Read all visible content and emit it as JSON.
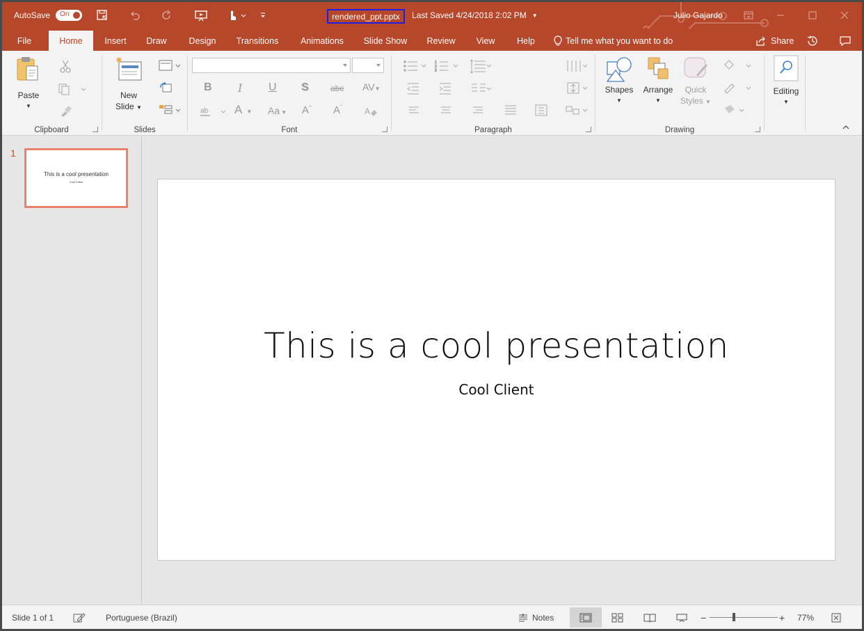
{
  "titlebar": {
    "autosave_label": "AutoSave",
    "autosave_state": "On",
    "filename": "rendered_ppt.pptx",
    "last_saved": "Last Saved 4/24/2018 2:02 PM",
    "user": "Julio Gajardo",
    "bg_color": "#b7472a"
  },
  "tabs": [
    "File",
    "Home",
    "Insert",
    "Draw",
    "Design",
    "Transitions",
    "Animations",
    "Slide Show",
    "Review",
    "View",
    "Help"
  ],
  "active_tab": "Home",
  "tell_me": "Tell me what you want to do",
  "share_label": "Share",
  "ribbon": {
    "clipboard": {
      "label": "Clipboard",
      "paste": "Paste"
    },
    "slides": {
      "label": "Slides",
      "new_slide_1": "New",
      "new_slide_2": "Slide"
    },
    "font": {
      "label": "Font",
      "font_name": "",
      "font_size": ""
    },
    "paragraph": {
      "label": "Paragraph"
    },
    "drawing": {
      "label": "Drawing",
      "shapes": "Shapes",
      "arrange": "Arrange",
      "quick_1": "Quick",
      "quick_2": "Styles"
    },
    "editing": {
      "label": "Editing"
    }
  },
  "thumbnail": {
    "number": "1",
    "title": "This is a cool presentation",
    "subtitle": "Cool Client"
  },
  "slide": {
    "title": "This is a cool presentation",
    "subtitle": "Cool Client"
  },
  "statusbar": {
    "slide_info": "Slide 1 of 1",
    "language": "Portuguese (Brazil)",
    "notes": "Notes",
    "zoom": "77%"
  },
  "icons": {
    "save": "save-icon",
    "undo": "undo-icon",
    "redo": "redo-icon",
    "present": "present-from-beginning-icon",
    "touch": "touch-mode-icon",
    "customize": "customize-qat-icon",
    "ribbon_display": "ribbon-display-options-icon",
    "minimize": "minimize-icon",
    "maximize": "maximize-icon",
    "close": "close-icon"
  }
}
